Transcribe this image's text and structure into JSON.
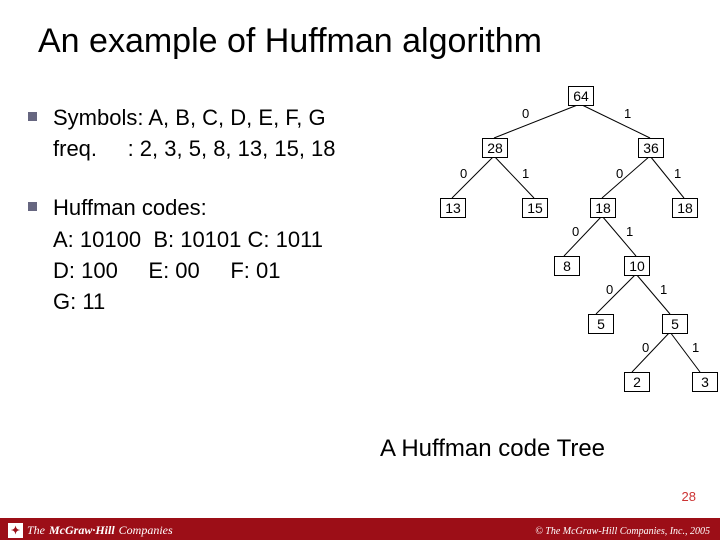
{
  "title": "An example of Huffman algorithm",
  "bullets": [
    {
      "line1": "Symbols: A, B, C, D, E, F, G",
      "line2": "freq.     : 2, 3, 5, 8, 13, 15, 18"
    },
    {
      "line1": "Huffman codes:",
      "codes": {
        "a": "A: 10100",
        "b": "B: 10101",
        "c": "C: 1011",
        "d": "D: 100",
        "e": "E: 00",
        "f": "F: 01",
        "g": "G: 11"
      }
    }
  ],
  "caption": "A Huffman code Tree",
  "page_number": "28",
  "footer": {
    "company_prefix": "The",
    "company_name": "McGraw·Hill",
    "company_suffix": "Companies",
    "copyright": "© The McGraw-Hill Companies, Inc., 2005"
  },
  "tree": {
    "nodes": {
      "n64": "64",
      "n28": "28",
      "n36": "36",
      "n13": "13",
      "n15": "15",
      "n18a": "18",
      "n18b": "18",
      "n8": "8",
      "n10": "10",
      "n5": "5",
      "n5b": "5",
      "n2": "2",
      "n3": "3"
    },
    "edges": {
      "e0": "0",
      "e1": "1"
    }
  },
  "chart_data": {
    "type": "table",
    "title": "Huffman tree nodes (value, parent, bit-from-parent)",
    "rows": [
      {
        "node": 64,
        "parent": null,
        "bit": null
      },
      {
        "node": 28,
        "parent": 64,
        "bit": 0
      },
      {
        "node": 36,
        "parent": 64,
        "bit": 1
      },
      {
        "node": 13,
        "parent": 28,
        "bit": 0
      },
      {
        "node": 15,
        "parent": 28,
        "bit": 1
      },
      {
        "node": 18,
        "parent": 36,
        "bit": 0,
        "id": "18a"
      },
      {
        "node": 18,
        "parent": 36,
        "bit": 1,
        "id": "18b"
      },
      {
        "node": 8,
        "parent": "18a",
        "bit": 0
      },
      {
        "node": 10,
        "parent": "18a",
        "bit": 1
      },
      {
        "node": 5,
        "parent": 10,
        "bit": 0,
        "id": "5a"
      },
      {
        "node": 5,
        "parent": 10,
        "bit": 1,
        "id": "5b"
      },
      {
        "node": 2,
        "parent": "5b",
        "bit": 0
      },
      {
        "node": 3,
        "parent": "5b",
        "bit": 1
      }
    ],
    "symbol_freq": {
      "A": 2,
      "B": 3,
      "C": 5,
      "D": 8,
      "E": 13,
      "F": 15,
      "G": 18
    },
    "codes": {
      "A": "10100",
      "B": "10101",
      "C": "1011",
      "D": "100",
      "E": "00",
      "F": "01",
      "G": "11"
    }
  }
}
